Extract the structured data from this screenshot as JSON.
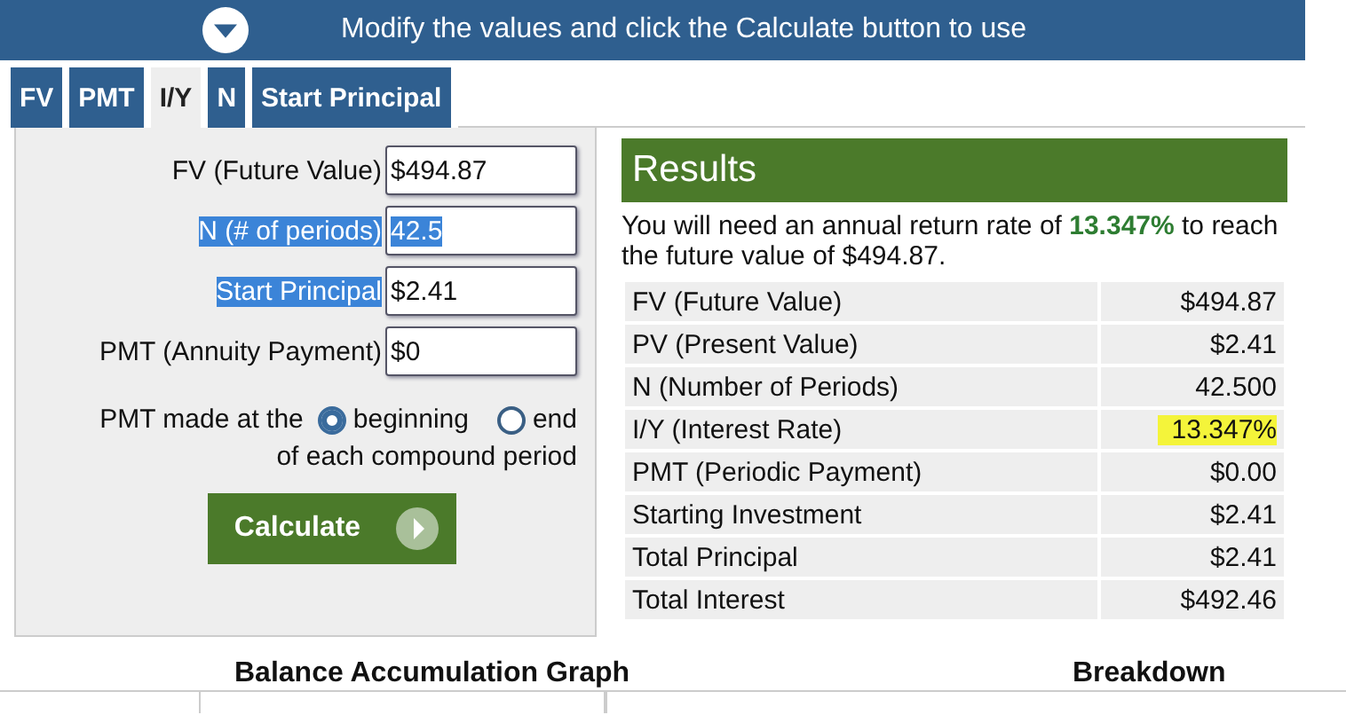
{
  "banner": {
    "text": "Modify the values and click the Calculate button to use"
  },
  "tabs": [
    {
      "label": "FV",
      "selected": false
    },
    {
      "label": "PMT",
      "selected": false
    },
    {
      "label": "I/Y",
      "selected": true
    },
    {
      "label": "N",
      "selected": false
    },
    {
      "label": "Start Principal",
      "selected": false
    }
  ],
  "fields": [
    {
      "label": "FV (Future Value)",
      "value": "$494.87",
      "label_highlighted": false,
      "value_highlighted": false
    },
    {
      "label": "N (# of periods)",
      "value": "42.5",
      "label_highlighted": true,
      "value_highlighted": true
    },
    {
      "label": "Start Principal",
      "value": "$2.41",
      "label_highlighted": true,
      "value_highlighted": false
    },
    {
      "label": "PMT (Annuity Payment)",
      "value": "$0",
      "label_highlighted": false,
      "value_highlighted": false
    }
  ],
  "pmt_timing": {
    "label": "PMT made at the",
    "options": [
      {
        "label": "beginning",
        "selected": true
      },
      {
        "label": "end",
        "selected": false
      }
    ],
    "suffix": "of each compound period"
  },
  "calculate_button": "Calculate",
  "results": {
    "title": "Results",
    "summary": "You will need an annual return rate of **13.347%** to reach the future value of $494.87.",
    "rows": [
      {
        "label": "FV (Future Value)",
        "value": "$494.87",
        "marked": false
      },
      {
        "label": "PV (Present Value)",
        "value": "$2.41",
        "marked": false
      },
      {
        "label": "N (Number of Periods)",
        "value": "42.500",
        "marked": false
      },
      {
        "label": "I/Y (Interest Rate)",
        "value": "13.347%",
        "marked": true
      },
      {
        "label": "PMT (Periodic Payment)",
        "value": "$0.00",
        "marked": false
      },
      {
        "label": "Starting Investment",
        "value": "$2.41",
        "marked": false
      },
      {
        "label": "Total Principal",
        "value": "$2.41",
        "marked": false
      },
      {
        "label": "Total Interest",
        "value": "$492.46",
        "marked": false
      }
    ]
  },
  "section_headings": [
    "Balance Accumulation Graph",
    "Breakdown"
  ]
}
